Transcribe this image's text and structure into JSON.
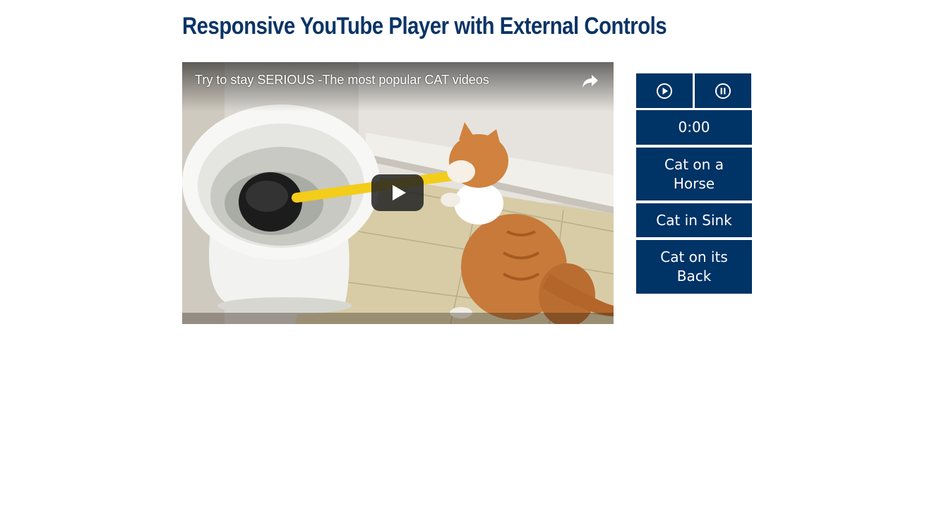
{
  "page": {
    "title": "Responsive YouTube Player with External Controls"
  },
  "player": {
    "video_title": "Try to stay SERIOUS -The most popular CAT videos",
    "share_icon": "share-arrow-icon",
    "play_icon": "youtube-play-icon"
  },
  "controls": {
    "play_icon": "play-circle-icon",
    "pause_icon": "pause-circle-icon",
    "time_display": "0:00",
    "chapters": [
      {
        "label": "Cat on a Horse"
      },
      {
        "label": "Cat in Sink"
      },
      {
        "label": "Cat on its Back"
      }
    ]
  },
  "colors": {
    "title": "#0b3466",
    "button_bg": "#003366",
    "button_text": "#ffffff",
    "page_bg": "#ffffff"
  }
}
